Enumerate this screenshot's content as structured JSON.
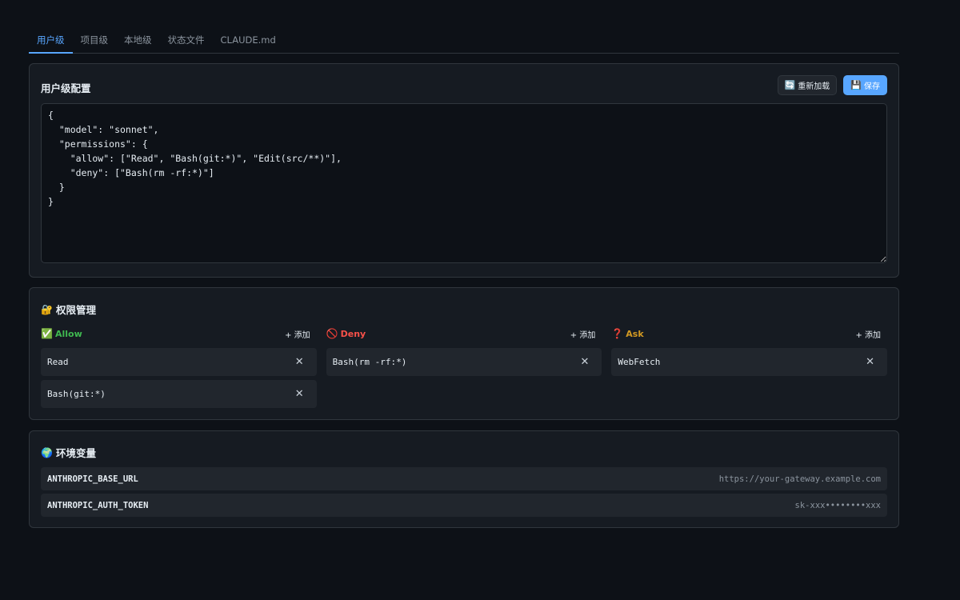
{
  "tabs": [
    {
      "label": "用户级",
      "active": true
    },
    {
      "label": "项目级",
      "active": false
    },
    {
      "label": "本地级",
      "active": false
    },
    {
      "label": "状态文件",
      "active": false
    },
    {
      "label": "CLAUDE.md",
      "active": false
    }
  ],
  "config": {
    "title": "用户级配置",
    "reload_label": "重新加载",
    "reload_icon": "reload-icon",
    "save_label": "保存",
    "save_icon": "floppy-disk-icon",
    "editor_value": "{\n  \"model\": \"sonnet\",\n  \"permissions\": {\n    \"allow\": [\"Read\", \"Bash(git:*)\", \"Edit(src/**)\"],\n    \"deny\": [\"Bash(rm -rf:*)\"]\n  }\n}"
  },
  "permissions": {
    "title": "权限管理",
    "title_icon": "lock-with-key-icon",
    "add_label": "+ 添加",
    "allow": {
      "label": "Allow",
      "icon": "check-mark-icon",
      "color": "#3fb950",
      "items": [
        "Read",
        "Bash(git:*)"
      ]
    },
    "deny": {
      "label": "Deny",
      "icon": "prohibited-icon",
      "color": "#f85149",
      "items": [
        "Bash(rm -rf:*)"
      ]
    },
    "ask": {
      "label": "Ask",
      "icon": "question-mark-icon",
      "color": "#d29922",
      "items": [
        "WebFetch"
      ]
    }
  },
  "env": {
    "title": "环境变量",
    "title_icon": "globe-icon",
    "vars": [
      {
        "key": "ANTHROPIC_BASE_URL",
        "value": "https://your-gateway.example.com"
      },
      {
        "key": "ANTHROPIC_AUTH_TOKEN",
        "value": "sk-xxx••••••••xxx"
      }
    ]
  },
  "colors": {
    "accent": "#58a6ff",
    "background": "#0d1117",
    "card": "#161b22"
  }
}
